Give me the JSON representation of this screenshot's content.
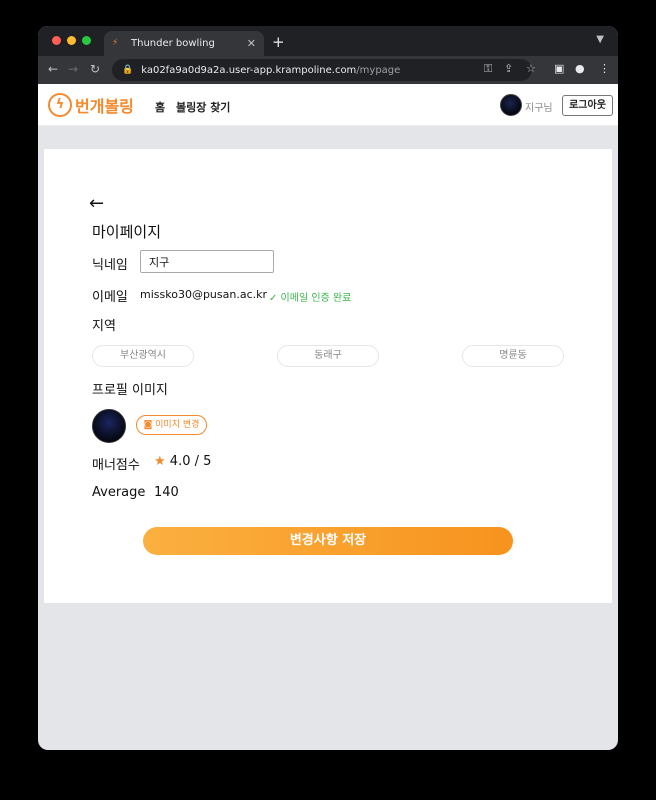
{
  "browser": {
    "tab_title": "Thunder bowling",
    "tab_close": "✕",
    "new_tab": "+",
    "url_host": "ka02fa9a0d9a2a.user-app.krampoline.com",
    "url_path": "/mypage"
  },
  "header": {
    "logo_text": "번개볼링",
    "nav": [
      "홈",
      "볼링장 찾기"
    ],
    "user_name": "지구님",
    "logout": "로그아웃"
  },
  "mypage": {
    "back": "←",
    "title": "마이페이지",
    "nickname_label": "닉네임",
    "nickname_value": "지구",
    "email_label": "이메일",
    "email_value": "missko30@pusan.ac.kr",
    "email_verified": "✓ 이메일 인증 완료",
    "region_label": "지역",
    "regions": [
      "부산광역시",
      "동래구",
      "명륜동"
    ],
    "profile_label": "프로필 이미지",
    "image_change": "이미지 변경",
    "manner_label": "매너점수",
    "manner_star": "★",
    "manner_value": "4.0 / 5",
    "average_label": "Average",
    "average_value": "140",
    "save_button": "변경사항 저장"
  },
  "colors": {
    "accent": "#f58a2c",
    "verified": "#3ab54a"
  }
}
